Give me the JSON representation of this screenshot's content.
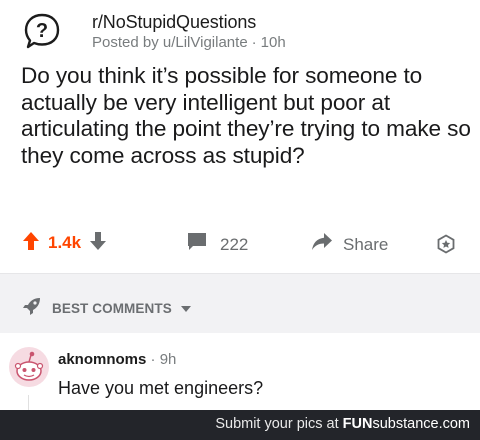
{
  "post": {
    "subreddit": "r/NoStupidQuestions",
    "posted_by": "Posted by u/LilVigilante",
    "age": "10h",
    "title": "Do you think it’s possible for someone to actually be very intelligent but poor at articulating the point they’re trying to make so they come across as stupid?"
  },
  "actions": {
    "votes": "1.4k",
    "comments": "222",
    "share_label": "Share"
  },
  "sort": {
    "label": "BEST COMMENTS"
  },
  "comment": {
    "author": "aknomnoms",
    "age": "9h",
    "body": "Have you met engineers?"
  },
  "footer": {
    "prefix": "Submit your pics at ",
    "brand_fun": "FUN",
    "brand_rest": "substance.com"
  },
  "colors": {
    "upvote": "#ff4500",
    "muted": "#878a8c",
    "footer_bg": "#23252a"
  },
  "icons": [
    "question-mark-icon",
    "upvote-arrow-icon",
    "downvote-arrow-icon",
    "comment-bubble-icon",
    "share-arrow-icon",
    "award-icon",
    "rocket-icon",
    "caret-down-icon",
    "snoo-avatar-icon"
  ]
}
